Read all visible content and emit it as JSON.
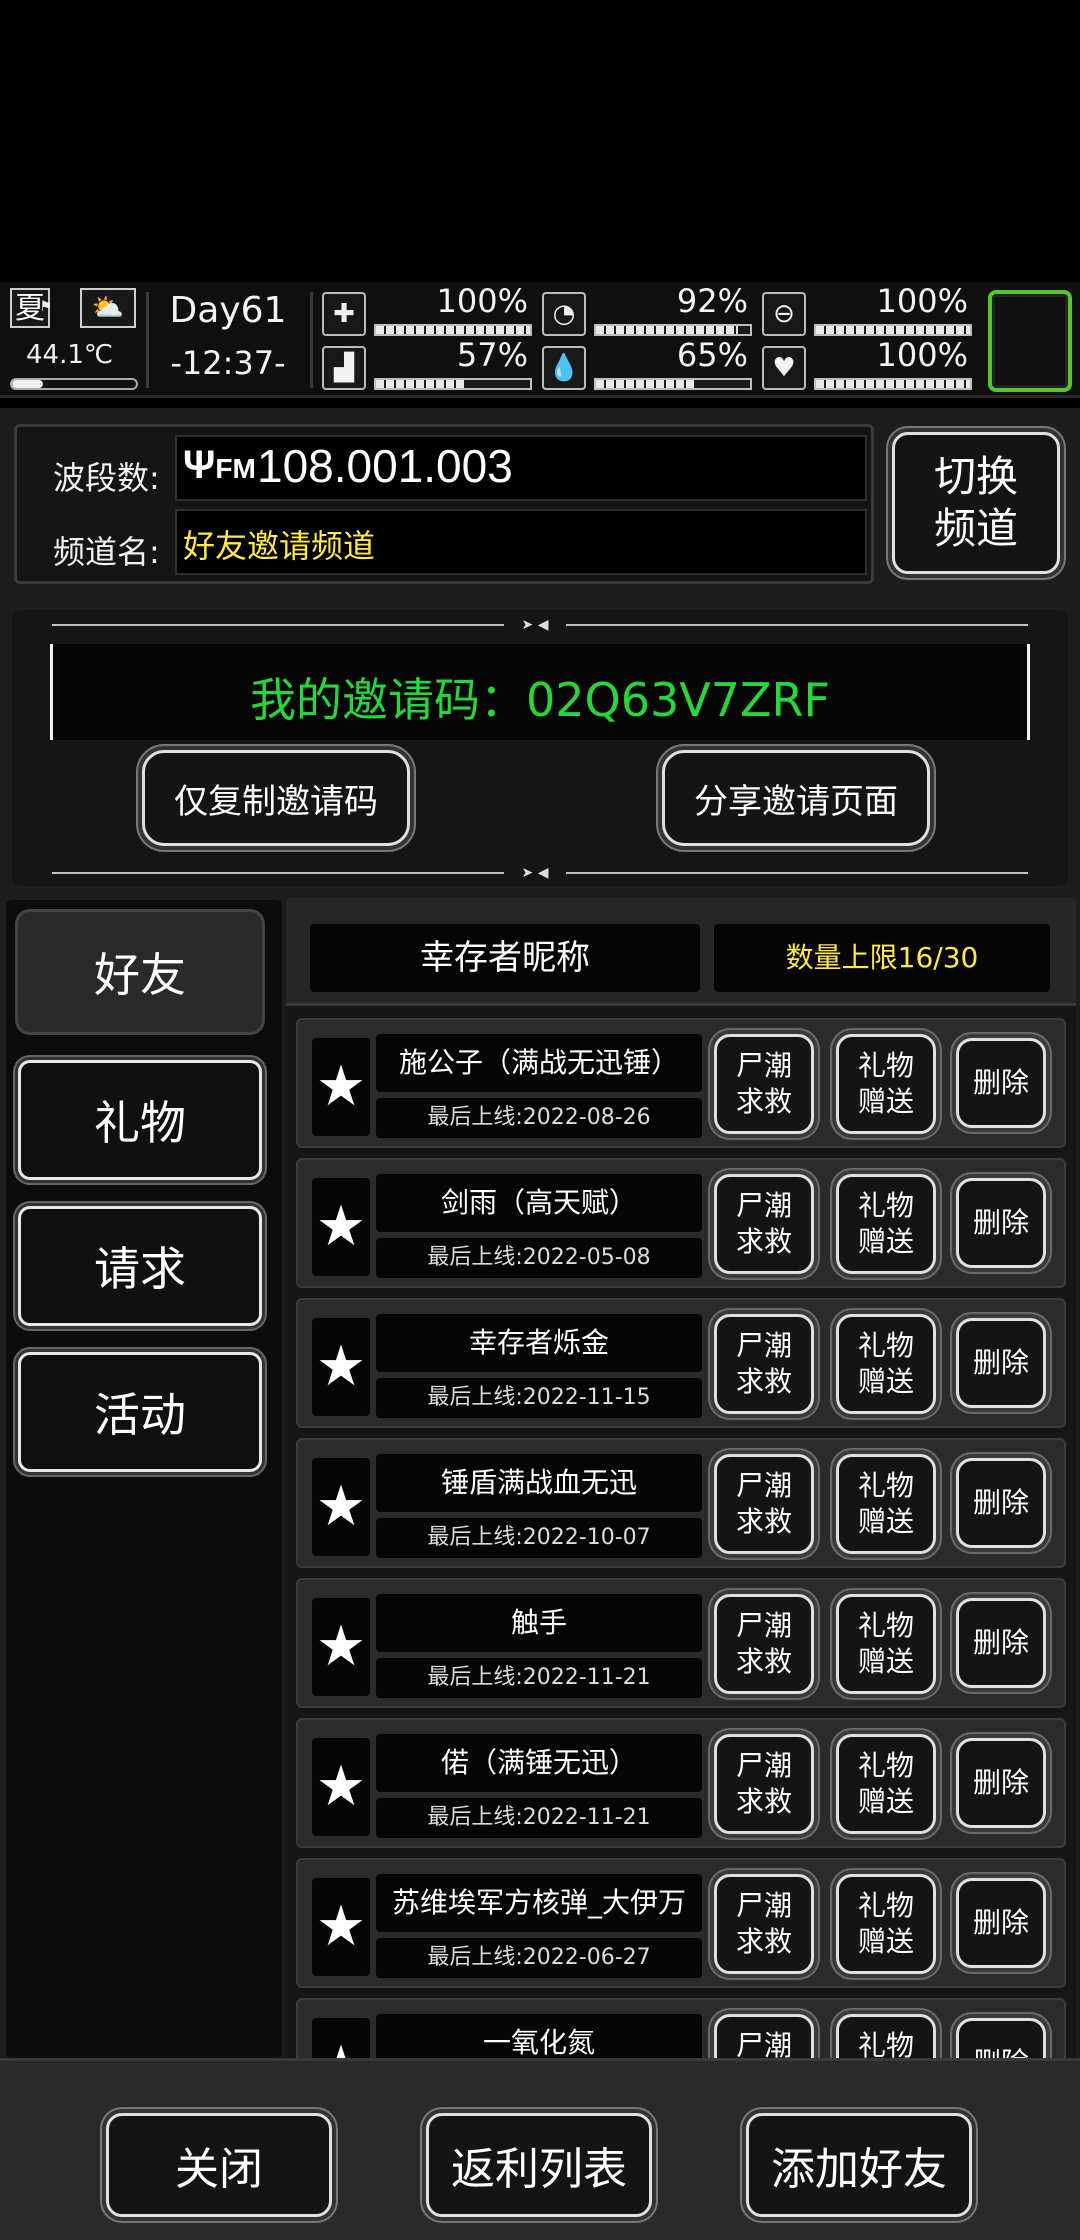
{
  "status": {
    "season": "夏",
    "weather_icon": "partly-cloudy-icon",
    "temperature": "44.1℃",
    "temperature_level": 0.25,
    "day": "Day61",
    "time": "-12:37-",
    "stats": [
      {
        "name": "health",
        "icon": "medkit-icon",
        "glyph": "✚",
        "value": "100%",
        "level": 1.0
      },
      {
        "name": "hunger",
        "icon": "stomach-icon",
        "glyph": "◔",
        "value": "92%",
        "level": 0.92
      },
      {
        "name": "medicine",
        "icon": "pill-icon",
        "glyph": "⊖",
        "value": "100%",
        "level": 1.0
      },
      {
        "name": "stamina",
        "icon": "foot-icon",
        "glyph": "▟",
        "value": "57%",
        "level": 0.57
      },
      {
        "name": "water",
        "icon": "water-drop-icon",
        "glyph": "💧",
        "value": "65%",
        "level": 0.65
      },
      {
        "name": "mood",
        "icon": "heart-icon",
        "glyph": "♥",
        "value": "100%",
        "level": 1.0
      }
    ]
  },
  "radio": {
    "band_label": "波段数:",
    "band_value": "108.001.003",
    "channel_label": "频道名:",
    "channel_name": "好友邀请频道",
    "switch_button": "切换\n频道"
  },
  "invite": {
    "code_text": "我的邀请码：02Q63V7ZRF",
    "copy_button": "仅复制邀请码",
    "share_button": "分享邀请页面"
  },
  "tabs": [
    "好友",
    "礼物",
    "请求",
    "活动"
  ],
  "list_header": {
    "nickname": "幸存者昵称",
    "limit": "数量上限16/30"
  },
  "friends": [
    {
      "name": "施公子（满战无迅锤）",
      "last_online": "最后上线:2022-08-26"
    },
    {
      "name": "剑雨（高天赋）",
      "last_online": "最后上线:2022-05-08"
    },
    {
      "name": "幸存者烁金",
      "last_online": "最后上线:2022-11-15"
    },
    {
      "name": "锤盾满战血无迅",
      "last_online": "最后上线:2022-10-07"
    },
    {
      "name": "触手",
      "last_online": "最后上线:2022-11-21"
    },
    {
      "name": "偌（满锤无迅）",
      "last_online": "最后上线:2022-11-21"
    },
    {
      "name": "苏维埃军方核弹_大伊万",
      "last_online": "最后上线:2022-06-27"
    },
    {
      "name": "一氧化氮",
      "last_online": ""
    }
  ],
  "row_buttons": {
    "rescue": "尸潮\n求救",
    "gift": "礼物\n赠送",
    "delete": "删除"
  },
  "bottom_buttons": [
    "关闭",
    "返利列表",
    "添加好友"
  ],
  "colors": {
    "accent_green": "#27d63a",
    "channel_yellow": "#ffe94d",
    "slot_border": "#56c62f"
  }
}
